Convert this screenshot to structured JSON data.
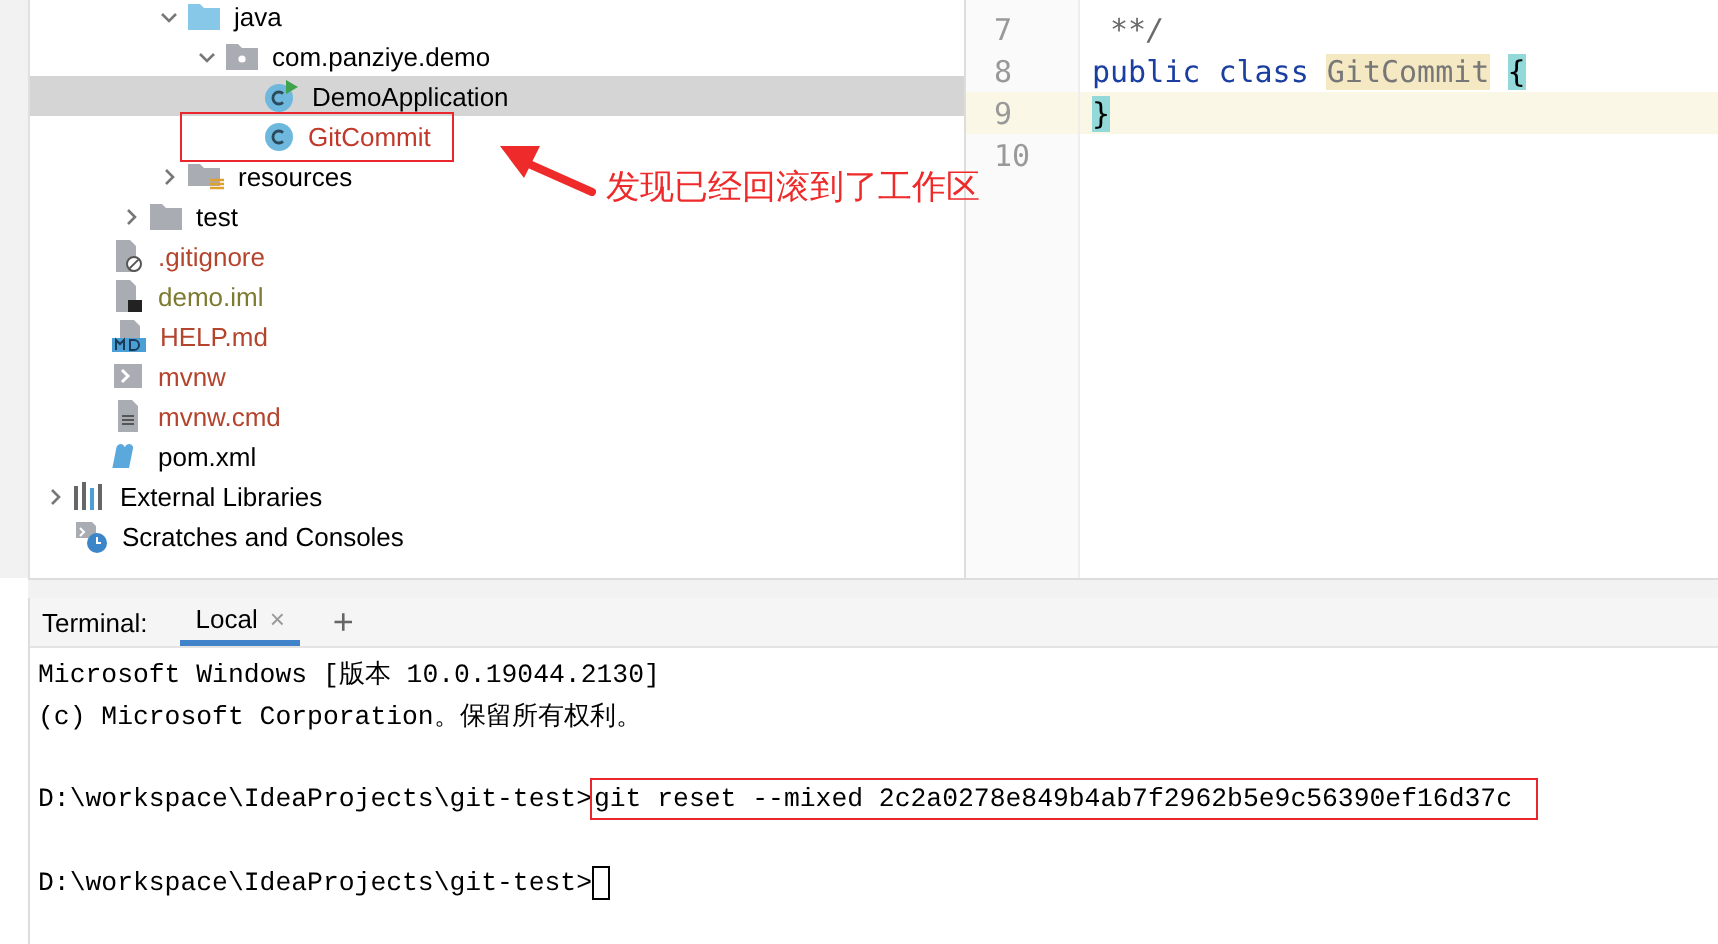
{
  "project_tree": [
    {
      "children": [
        {
          "children": [
            {
              "children": [
                {
                  "label": "java",
                  "kind": "folder-source",
                  "expanded": true,
                  "selected": false,
                  "color": "#000000",
                  "children": [
                    {
                      "label": "com.panziye.demo",
                      "kind": "package",
                      "expanded": true,
                      "selected": false,
                      "color": "#000000",
                      "children": [
                        {
                          "label": "DemoApplication",
                          "kind": "class-run",
                          "selected": true,
                          "color": "#000000"
                        },
                        {
                          "label": "GitCommit",
                          "kind": "class",
                          "selected": false,
                          "color": "#c0392b",
                          "annotated": true
                        }
                      ]
                    }
                  ]
                },
                {
                  "label": "resources",
                  "kind": "folder-resources",
                  "expanded": false,
                  "selected": false,
                  "color": "#000000"
                }
              ]
            },
            {
              "label": "test",
              "kind": "folder",
              "expanded": false,
              "selected": false,
              "color": "#000000"
            }
          ]
        },
        {
          "label": ".gitignore",
          "kind": "file-ignore",
          "selected": false,
          "color": "#b5442d"
        },
        {
          "label": "demo.iml",
          "kind": "file-iml",
          "selected": false,
          "color": "#7d7b2f"
        },
        {
          "label": "HELP.md",
          "kind": "file-md",
          "selected": false,
          "color": "#b5442d"
        },
        {
          "label": "mvnw",
          "kind": "file-script",
          "selected": false,
          "color": "#b5442d"
        },
        {
          "label": "mvnw.cmd",
          "kind": "file-text",
          "selected": false,
          "color": "#b5442d"
        },
        {
          "label": "pom.xml",
          "kind": "file-maven",
          "selected": false,
          "color": "#000000"
        }
      ]
    },
    {
      "label": "External Libraries",
      "kind": "libraries",
      "expanded": false,
      "selected": false,
      "color": "#000000"
    },
    {
      "label": "Scratches and Consoles",
      "kind": "scratches",
      "selected": false,
      "color": "#000000"
    }
  ],
  "callout": {
    "text": "发现已经回滚到了工作区"
  },
  "editor": {
    "lines": [
      {
        "number": "7",
        "current": false,
        "tokens": [
          {
            "kind": "comment",
            "text": " **/"
          }
        ]
      },
      {
        "number": "8",
        "current": false,
        "tokens": [
          {
            "kind": "keyword",
            "text": "public "
          },
          {
            "kind": "keyword",
            "text": "class "
          },
          {
            "kind": "highlight",
            "text": "GitCommit"
          },
          {
            "kind": "brace-match",
            "text": "{",
            "space_before": true
          }
        ]
      },
      {
        "number": "9",
        "current": true,
        "tokens": [
          {
            "kind": "brace-match",
            "text": "}"
          }
        ]
      },
      {
        "number": "10",
        "current": false
      }
    ]
  },
  "terminal": {
    "label": "Terminal:",
    "tabs": [
      {
        "label": "Local",
        "close": "×",
        "selected": true
      }
    ],
    "add": "+",
    "blocks": [
      {
        "lines": [
          {
            "text": "Microsoft Windows [版本 10.0.19044.2130]"
          },
          {
            "text": "(c) Microsoft Corporation。保留所有权利。"
          }
        ]
      },
      {
        "lines": [
          {
            "prompt": "D:\\workspace\\IdeaProjects\\git-test>",
            "command": "git reset --mixed 2c2a0278e849b4ab7f2962b5e9c56390ef16d37c",
            "boxed": true
          }
        ]
      },
      {
        "lines": [
          {
            "prompt": "D:\\workspace\\IdeaProjects\\git-test>",
            "cursor": true
          }
        ]
      }
    ]
  }
}
